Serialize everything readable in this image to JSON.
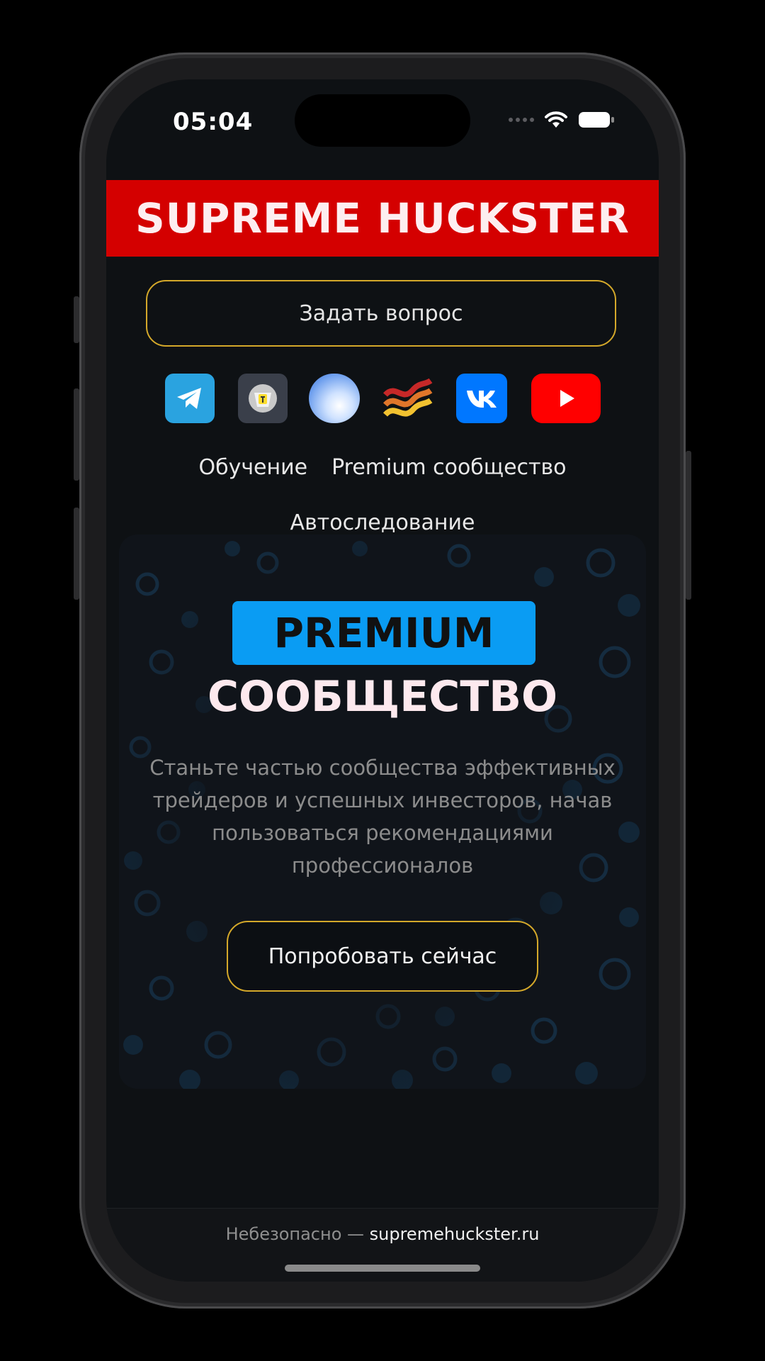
{
  "status_bar": {
    "time": "05:04"
  },
  "brand": {
    "title": "SUPREME HUCKSTER",
    "color": "#d40000"
  },
  "ask_button": {
    "label": "Задать вопрос"
  },
  "socials": [
    {
      "name": "telegram-icon",
      "color": "#2aa3e0"
    },
    {
      "name": "tinkoff-pulse-icon",
      "color": "#3a3f4a"
    },
    {
      "name": "sphere-icon",
      "color": "#9fc5ff"
    },
    {
      "name": "smartlab-icon",
      "color": "#d94a1a"
    },
    {
      "name": "vk-icon",
      "color": "#0077ff"
    },
    {
      "name": "youtube-icon",
      "color": "#ff0000"
    }
  ],
  "nav": {
    "education": "Обучение",
    "premium_community": "Premium сообщество",
    "autofollow": "Автоследование"
  },
  "promo": {
    "badge": "PREMIUM",
    "title": "СООБЩЕСТВО",
    "description": "Станьте частью сообщества эффективных трейдеров и успешных инвесторов, начав пользоваться рекомендациями профессионалов",
    "cta": "Попробовать сейчас",
    "accent_color": "#0a9cf3",
    "button_border_color": "#d4a82a"
  },
  "url_bar": {
    "security": "Небезопасно —",
    "domain": "supremehuckster.ru"
  }
}
